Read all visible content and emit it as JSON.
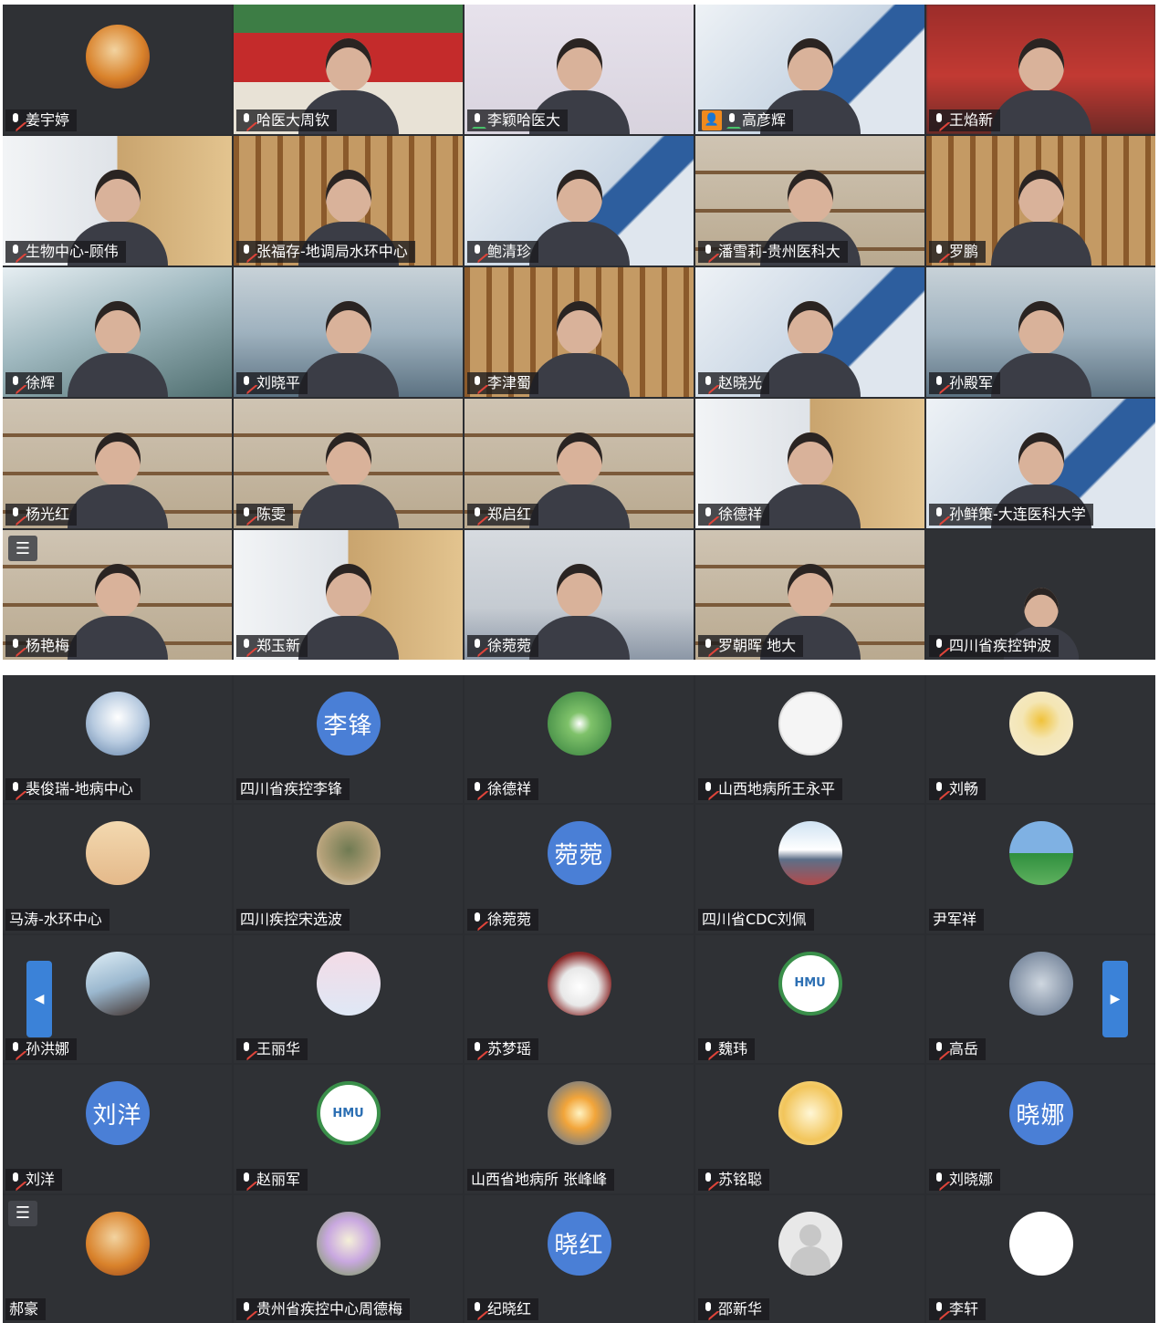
{
  "video_grid": {
    "menu_icon": "list-menu-icon",
    "tiles": [
      {
        "name": "姜宇婷",
        "scene": "plain",
        "avatar": true
      },
      {
        "name": "哈医大周钦",
        "scene": "gate"
      },
      {
        "name": "李颖哈医大",
        "scene": "purple",
        "mic": "on",
        "active": true
      },
      {
        "name": "高彦辉",
        "scene": "office",
        "badge": "host-icon",
        "mic": "on"
      },
      {
        "name": "王焰新",
        "scene": "redwall"
      },
      {
        "name": "生物中心-顾伟",
        "scene": "window"
      },
      {
        "name": "张福存-地调局水环中心",
        "scene": "library"
      },
      {
        "name": "鲍清珍",
        "scene": "office"
      },
      {
        "name": "潘雪莉-贵州医科大",
        "scene": "shelf"
      },
      {
        "name": "罗鹏",
        "scene": "library"
      },
      {
        "name": "徐辉",
        "scene": "snow"
      },
      {
        "name": "刘晓平",
        "scene": "building"
      },
      {
        "name": "李津蜀",
        "scene": "library"
      },
      {
        "name": "赵晓光",
        "scene": "office"
      },
      {
        "name": "孙殿军",
        "scene": "building"
      },
      {
        "name": "杨光红",
        "scene": "shelf"
      },
      {
        "name": "陈雯",
        "scene": "shelf"
      },
      {
        "name": "郑启红",
        "scene": "shelf"
      },
      {
        "name": "徐德祥",
        "scene": "window"
      },
      {
        "name": "孙鲜策-大连医科大学",
        "scene": "office"
      },
      {
        "name": "杨艳梅",
        "scene": "shelf"
      },
      {
        "name": "郑玉新",
        "scene": "window"
      },
      {
        "name": "徐菀菀",
        "scene": "room"
      },
      {
        "name": "罗朝晖 地大",
        "scene": "shelf"
      },
      {
        "name": "四川省疾控钟波",
        "scene": "plain",
        "small": true
      }
    ]
  },
  "avatar_grid": {
    "menu_icon": "list-menu-icon",
    "prev_icon": "chevron-left-icon",
    "next_icon": "chevron-right-icon",
    "tiles": [
      {
        "name": "裴俊瑞-地病中心",
        "avatar": "av-winter",
        "mic": true
      },
      {
        "name": "四川省疾控李锋",
        "avatar": "letter",
        "letter": "李锋",
        "mic": false
      },
      {
        "name": "徐德祥",
        "avatar": "av-leaf",
        "mic": true
      },
      {
        "name": "山西地病所王永平",
        "avatar": "av-note",
        "mic": true
      },
      {
        "name": "刘畅",
        "avatar": "av-sun",
        "mic": true
      },
      {
        "name": "马涛-水环中心",
        "avatar": "av-deer",
        "mic": false
      },
      {
        "name": "四川疾控宋选波",
        "avatar": "av-soldier",
        "mic": false
      },
      {
        "name": "徐菀菀",
        "avatar": "letter",
        "letter": "菀菀",
        "mic": true
      },
      {
        "name": "四川省CDC刘佩",
        "avatar": "av-mountain",
        "mic": false
      },
      {
        "name": "尹军祥",
        "avatar": "av-field",
        "mic": false
      },
      {
        "name": "孙洪娜",
        "avatar": "av-girl",
        "mic": true
      },
      {
        "name": "王丽华",
        "avatar": "av-cloud",
        "mic": true
      },
      {
        "name": "苏梦瑶",
        "avatar": "av-cat",
        "mic": true
      },
      {
        "name": "魏玮",
        "avatar": "av-hmu",
        "mic": true,
        "logo": "HMU"
      },
      {
        "name": "高岳",
        "avatar": "av-dark",
        "mic": true
      },
      {
        "name": "刘洋",
        "avatar": "letter",
        "letter": "刘洋",
        "mic": true
      },
      {
        "name": "赵丽军",
        "avatar": "av-hmu",
        "mic": true,
        "logo": "HMU"
      },
      {
        "name": "山西省地病所 张峰峰",
        "avatar": "av-sunset",
        "mic": false
      },
      {
        "name": "苏铭聪",
        "avatar": "av-yellow",
        "mic": true
      },
      {
        "name": "刘晓娜",
        "avatar": "letter",
        "letter": "晓娜",
        "mic": true
      },
      {
        "name": "郝豪",
        "avatar": "av-orange",
        "mic": false
      },
      {
        "name": "贵州省疾控中心周德梅",
        "avatar": "av-flower",
        "mic": true
      },
      {
        "name": "纪晓红",
        "avatar": "letter",
        "letter": "晓红",
        "mic": true
      },
      {
        "name": "邵新华",
        "avatar": "av-blank",
        "mic": true
      },
      {
        "name": "李轩",
        "avatar": "av-power",
        "mic": true
      }
    ]
  },
  "colors": {
    "panel_bg": "#2b2d31",
    "letter_avatar": "#4a7fd6",
    "nav_arrow": "#3b82d8",
    "mic_muted": "#e0443a",
    "mic_active": "#48c26a",
    "host_badge": "#f08a1e"
  }
}
